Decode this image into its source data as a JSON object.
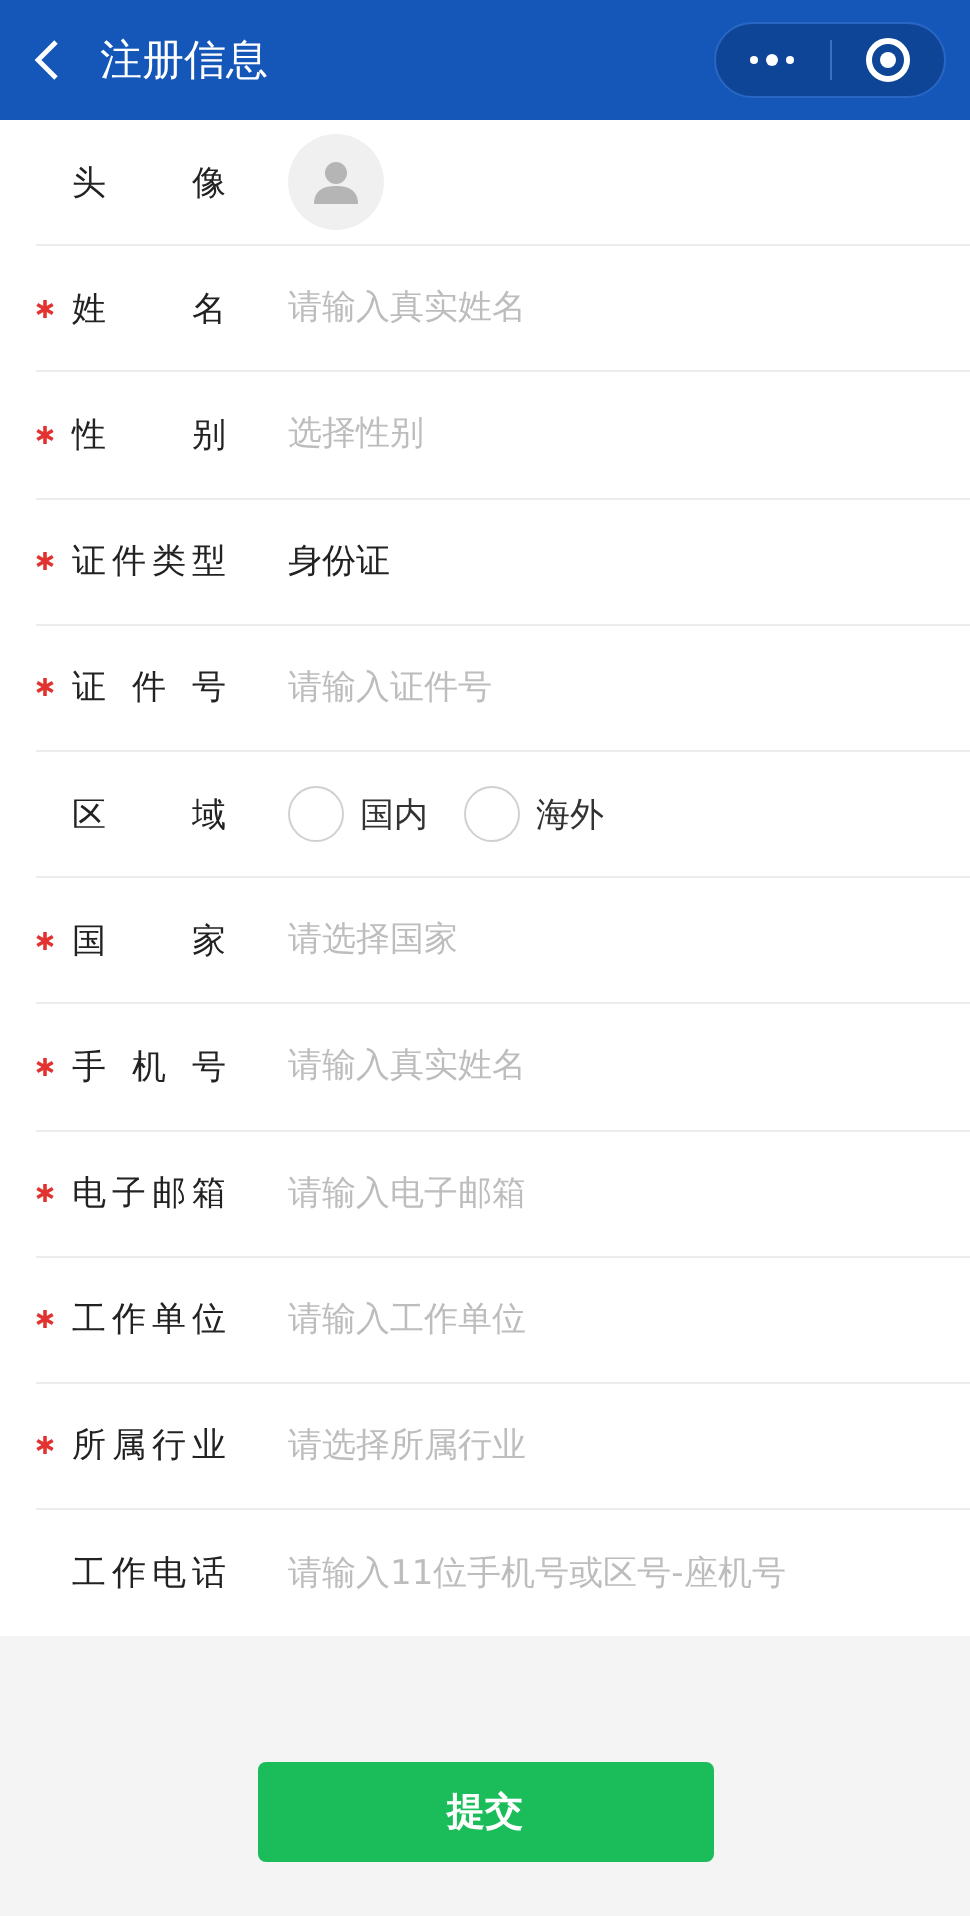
{
  "header": {
    "title": "注册信息"
  },
  "fields": [
    {
      "kind": "avatar",
      "label": "头 像",
      "required": false
    },
    {
      "kind": "input",
      "label": "姓 名",
      "required": true,
      "placeholder": "请输入真实姓名"
    },
    {
      "kind": "input",
      "label": "性 别",
      "required": true,
      "placeholder": "选择性别"
    },
    {
      "kind": "value",
      "label": "证件类型",
      "required": true,
      "value": "身份证"
    },
    {
      "kind": "input",
      "label": "证 件 号",
      "required": true,
      "placeholder": "请输入证件号"
    },
    {
      "kind": "radio",
      "label": "区 域",
      "required": false,
      "options": [
        {
          "label": "国内",
          "selected": false
        },
        {
          "label": "海外",
          "selected": false
        }
      ]
    },
    {
      "kind": "input",
      "label": "国 家",
      "required": true,
      "placeholder": "请选择国家"
    },
    {
      "kind": "input",
      "label": "手 机 号",
      "required": true,
      "placeholder": "请输入真实姓名"
    },
    {
      "kind": "input",
      "label": "电子邮箱",
      "required": true,
      "placeholder": "请输入电子邮箱"
    },
    {
      "kind": "input",
      "label": "工作单位",
      "required": true,
      "placeholder": "请输入工作单位"
    },
    {
      "kind": "input",
      "label": "所属行业",
      "required": true,
      "placeholder": "请选择所属行业"
    },
    {
      "kind": "input",
      "label": "工作电话",
      "required": false,
      "placeholder": "请输入11位手机号或区号-座机号"
    }
  ],
  "submit_button": "提交"
}
